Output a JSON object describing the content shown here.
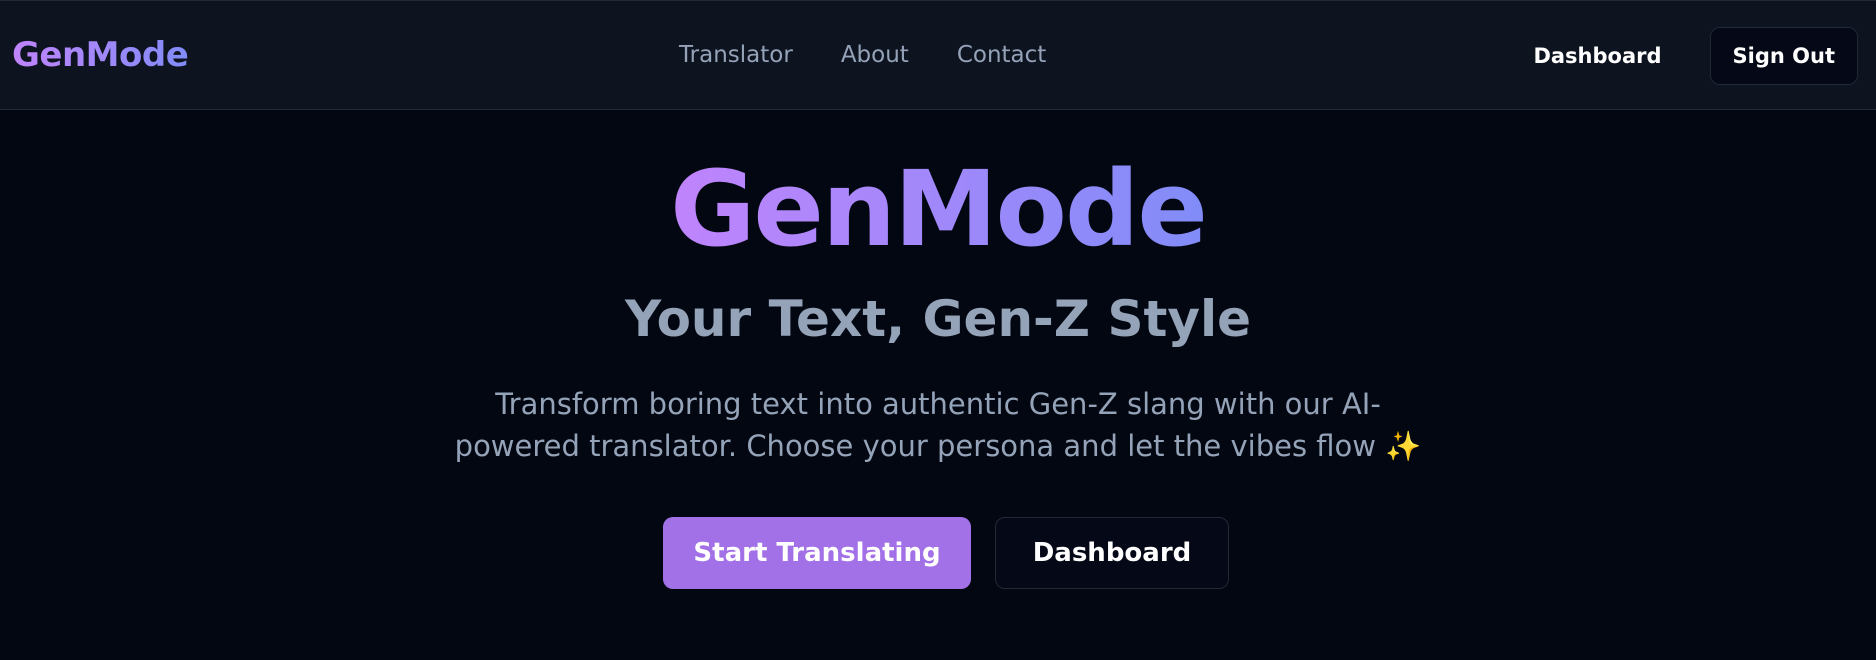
{
  "nav": {
    "brand": "GenMode",
    "links": [
      "Translator",
      "About",
      "Contact"
    ],
    "dashboard_label": "Dashboard",
    "signout_label": "Sign Out"
  },
  "hero": {
    "title": "GenMode",
    "subtitle": "Your Text, Gen-Z Style",
    "description": "Transform boring text into authentic Gen-Z slang with our AI-powered translator. Choose your persona and let the vibes flow ✨",
    "primary_cta": "Start Translating",
    "secondary_cta": "Dashboard"
  },
  "colors": {
    "background": "#030712",
    "navbar": "#0e1320",
    "gradient_start": "#c084fc",
    "gradient_end": "#818cf8",
    "primary_button": "#a371e7",
    "muted_text": "#94a3b8"
  }
}
